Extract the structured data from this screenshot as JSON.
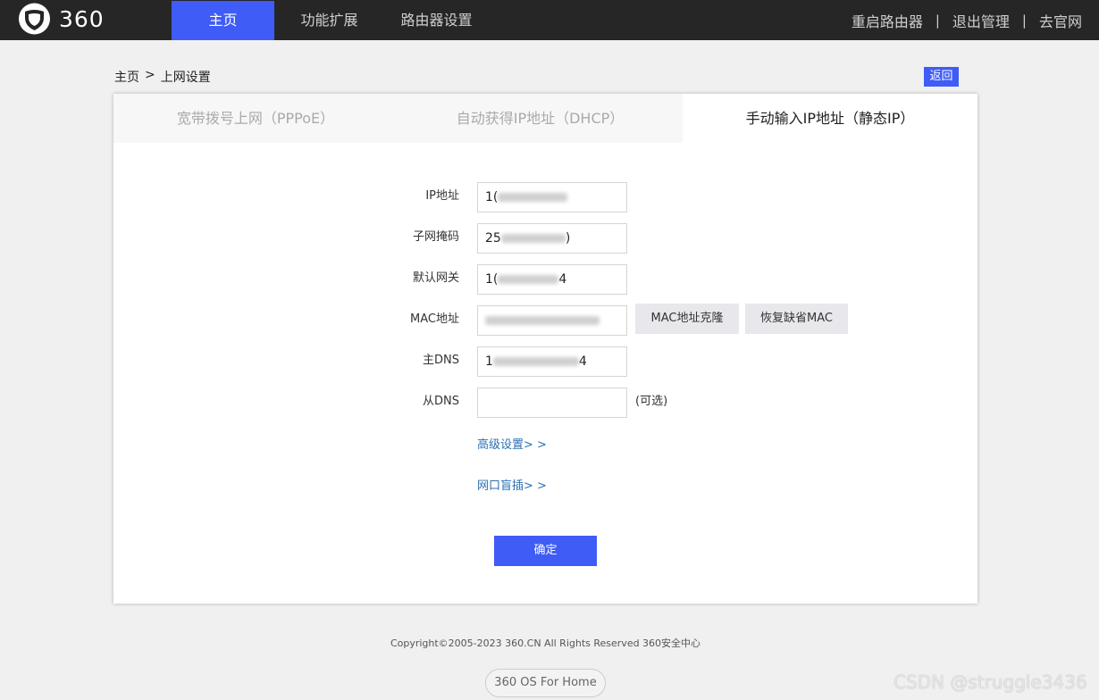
{
  "header": {
    "logo_text": "360",
    "nav": [
      "主页",
      "功能扩展",
      "路由器设置"
    ],
    "right_links": [
      "重启路由器",
      "退出管理",
      "去官网"
    ],
    "separator": "|"
  },
  "breadcrumb": {
    "home": "主页",
    "sep": ">",
    "current": "上网设置",
    "back_label": "返回"
  },
  "tabs": [
    "宽带拨号上网（PPPoE）",
    "自动获得IP地址（DHCP）",
    "手动输入IP地址（静态IP）"
  ],
  "form": {
    "ip_label": "IP地址",
    "ip_prefix": "1(",
    "mask_label": "子网掩码",
    "mask_prefix": "25",
    "mask_suffix": ")",
    "gateway_label": "默认网关",
    "gateway_prefix": "1(",
    "gateway_suffix": "4",
    "mac_label": "MAC地址",
    "mac_clone_label": "MAC地址克隆",
    "mac_restore_label": "恢复缺省MAC",
    "dns1_label": "主DNS",
    "dns1_prefix": "1",
    "dns1_suffix": "4",
    "dns2_label": "从DNS",
    "dns2_value": "",
    "dns2_optional": "(可选)",
    "advanced_link": "高级设置> >",
    "port_blind_link": "网口盲插> >",
    "confirm_label": "确定"
  },
  "footer": {
    "copyright": "Copyright©2005-2023 360.CN All Rights Reserved 360安全中心",
    "os_label": "360 OS For Home",
    "watermark": "CSDN @struggle3436"
  },
  "colors": {
    "accent": "#3f5cf6",
    "topbar": "#262626",
    "link": "#2c6fb3"
  }
}
